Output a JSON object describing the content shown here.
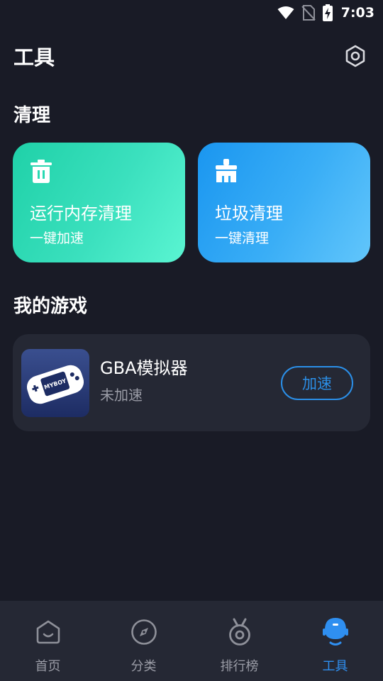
{
  "status_bar": {
    "time": "7:03"
  },
  "header": {
    "title": "工具"
  },
  "sections": {
    "clean": "清理",
    "games": "我的游戏"
  },
  "clean_cards": [
    {
      "title": "运行内存清理",
      "subtitle": "一键加速",
      "icon": "trash-icon"
    },
    {
      "title": "垃圾清理",
      "subtitle": "一键清理",
      "icon": "broom-icon"
    }
  ],
  "games": [
    {
      "name": "GBA模拟器",
      "status": "未加速",
      "action": "加速",
      "icon_text": "MYBOY"
    }
  ],
  "nav": [
    {
      "label": "首页",
      "icon": "home-icon",
      "active": false
    },
    {
      "label": "分类",
      "icon": "compass-icon",
      "active": false
    },
    {
      "label": "排行榜",
      "icon": "medal-icon",
      "active": false
    },
    {
      "label": "工具",
      "icon": "robot-icon",
      "active": true
    }
  ],
  "colors": {
    "background": "#191b26",
    "card_surface": "#252834",
    "accent": "#2f8ff0",
    "memory_card": "#2ad9b2",
    "junk_card": "#2aa6f4",
    "muted_text": "#9a9ca6"
  }
}
